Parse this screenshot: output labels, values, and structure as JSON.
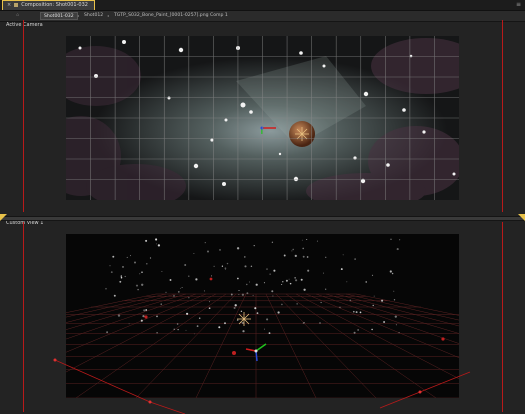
{
  "panel": {
    "icon": "composition-icon",
    "close_glyph": "×",
    "title": "Composition: Shot001-032",
    "menu_glyph": "≡"
  },
  "breadcrumbs": {
    "lock_glyph": "⌂",
    "items": [
      {
        "label": "Shot001-032",
        "current": true
      },
      {
        "label": "Shot012",
        "current": false
      },
      {
        "label": "TGTP_S032_Bone_Paint_[0001-0257].png Comp 1",
        "current": false
      }
    ],
    "separator": "◂"
  },
  "views": {
    "top_label": "Active Camera",
    "bottom_label": "Custom View 1"
  },
  "colors": {
    "accent": "#e8c24a",
    "guide": "#b81a1a",
    "axis_x": "#d01c1c",
    "axis_y": "#1fc41f",
    "axis_z": "#2a4ad8"
  }
}
